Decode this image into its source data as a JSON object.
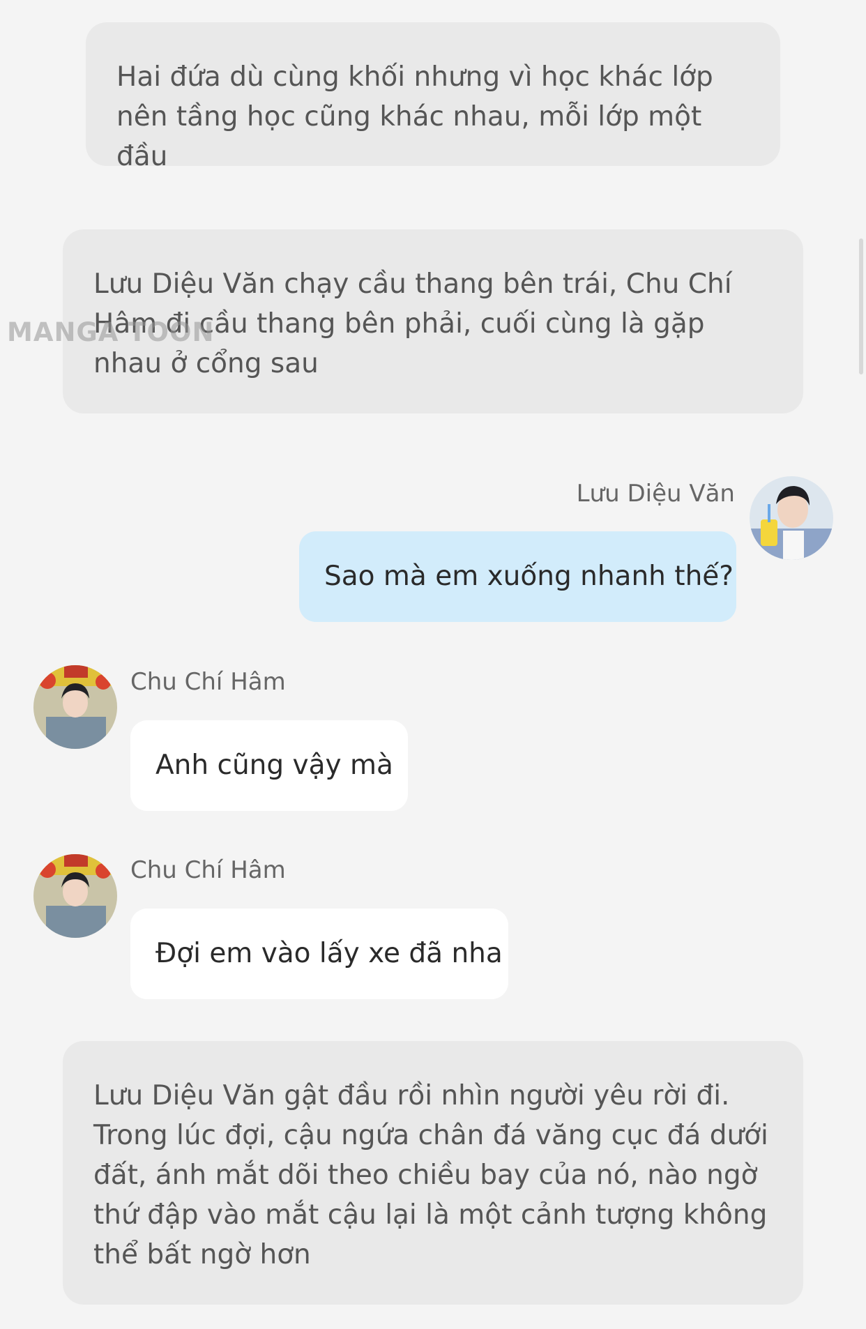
{
  "narrations": [
    "Hai đứa dù cùng khối nhưng vì học khác lớp nên tầng học cũng khác nhau, mỗi lớp một đầu",
    "Lưu Diệu Văn chạy cầu thang bên trái, Chu Chí Hâm đi cầu thang bên phải, cuối cùng là gặp nhau ở cổng sau",
    "Lưu Diệu Văn gật đầu rồi nhìn người yêu rời đi. Trong lúc đợi, cậu ngứa chân đá văng cục đá dưới đất, ánh mắt dõi theo chiều bay của nó, nào ngờ thứ đập vào mắt cậu lại là một cảnh tượng không thể bất ngờ hơn"
  ],
  "messages": [
    {
      "sender": "Lưu Diệu Văn",
      "text": "Sao mà em xuống nhanh thế?",
      "side": "right"
    },
    {
      "sender": "Chu Chí Hâm",
      "text": "Anh cũng vậy mà",
      "side": "left"
    },
    {
      "sender": "Chu Chí Hâm",
      "text": "Đợi em vào lấy xe đã nha",
      "side": "left"
    }
  ],
  "watermark": "MANGA TOON",
  "colors": {
    "background": "#f4f4f4",
    "narration_bg": "#e9e9e9",
    "outgoing_bubble": "#d2ecfb",
    "incoming_bubble": "#ffffff"
  }
}
